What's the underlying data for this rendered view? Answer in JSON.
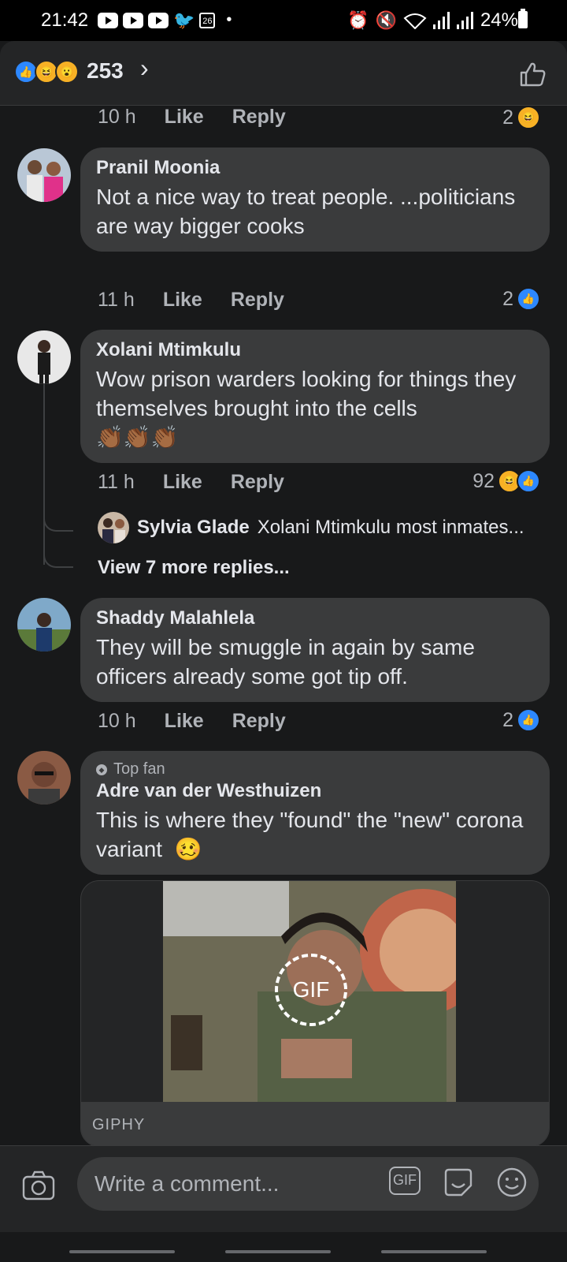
{
  "status_bar": {
    "time": "21:42",
    "calendar_day": "26",
    "battery": "24%"
  },
  "header": {
    "reaction_count": "253"
  },
  "comments": [
    {
      "time": "10 h",
      "like": "Like",
      "reply": "Reply",
      "reaction_count": "2"
    },
    {
      "author": "Pranil Moonia",
      "text": "Not a nice way to treat people. ...politicians are way bigger cooks",
      "time": "11 h",
      "like": "Like",
      "reply": "Reply",
      "reaction_count": "2"
    },
    {
      "author": "Xolani Mtimkulu",
      "text": "Wow prison warders looking for things they themselves brought into the cells",
      "emoji": "👏🏾👏🏾👏🏾",
      "time": "11 h",
      "like": "Like",
      "reply": "Reply",
      "reaction_count": "92",
      "reply_preview": {
        "author": "Sylvia Glade",
        "text": "Xolani Mtimkulu most inmates..."
      },
      "more_replies": "View 7 more replies..."
    },
    {
      "author": "Shaddy Malahlela",
      "text": "They will be smuggle in again by same officers already some got tip off.",
      "time": "10 h",
      "like": "Like",
      "reply": "Reply",
      "reaction_count": "2"
    },
    {
      "badge": "Top fan",
      "author": "Adre van der Westhuizen",
      "text": "This is where they \"found\" the \"new\" corona variant",
      "emoji": "🥴",
      "gif_badge": "GIF",
      "gif_source": "GIPHY"
    }
  ],
  "composer": {
    "placeholder": "Write a comment...",
    "gif_button": "GIF"
  },
  "colors": {
    "like_blue": "#2d88ff",
    "haha_yellow": "#f7b125",
    "bubble": "#3a3b3c",
    "background": "#18191a"
  }
}
